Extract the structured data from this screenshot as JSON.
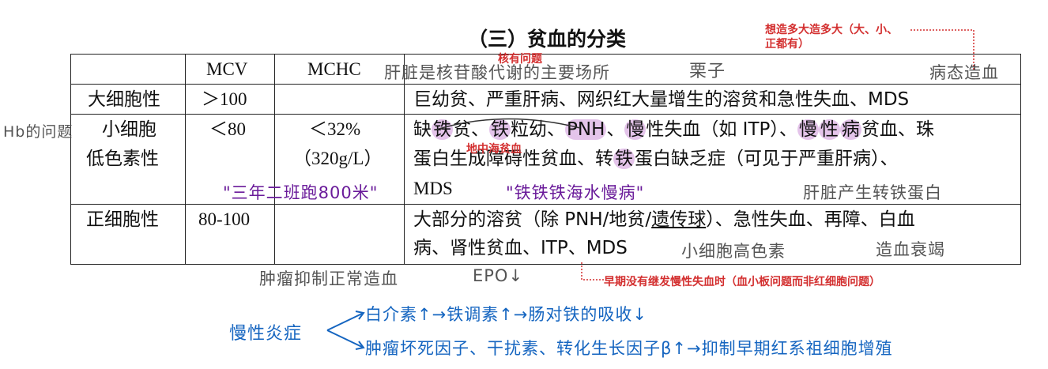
{
  "title": "（三）贫血的分类",
  "table": {
    "header": {
      "mcv": "MCV",
      "mchc": "MCHC"
    },
    "rows": [
      {
        "type": "大细胞性",
        "mcv": "＞100",
        "mchc": "",
        "diseases": "巨幼贫、严重肝病、网织红大量增生的溶贫和急性失血、MDS"
      },
      {
        "type_line1": "小细胞",
        "type_line2": "低色素性",
        "mcv": "＜80",
        "mchc_line1": "＜32%",
        "mchc_line2": "（320g/L）",
        "diseases_parts": [
          "缺",
          "铁",
          "贫、",
          "铁",
          "粒幼、",
          "PNH",
          "、",
          "慢",
          "性失血（如 ITP）、",
          "慢",
          "性",
          "病",
          "贫血、珠"
        ],
        "diseases_line2_parts": [
          "蛋白生成障碍性贫血、转",
          "铁",
          "蛋白缺乏症（可见于严重肝病）、"
        ],
        "diseases_line3": "MDS"
      },
      {
        "type": "正细胞性",
        "mcv": "80-100",
        "mchc": "",
        "diseases_line1_parts": [
          "大部分的溶贫（除 PNH/地贫/",
          "遗传球",
          "）、急性失血、再障、白血"
        ],
        "diseases_line2": "病、肾性贫血、ITP、MDS"
      }
    ]
  },
  "annotations": {
    "top_right_note_line1": "想造多大造多大（大、小、",
    "top_right_note_line2": "正都有）",
    "nuclear_problem": "核有问题",
    "liver_note": "肝脏是核苷酸代谢的主要场所",
    "chestnut": "栗子",
    "pathological_hematopoiesis": "病态造血",
    "hb_problem": "Hb的问题",
    "thalassemia": "地中海贫血",
    "mnemonic_1": "\"三年二班跑800米\"",
    "mnemonic_2": "\"铁铁铁海水慢病\"",
    "liver_transferrin": "肝脏产生转铁蛋白",
    "microcytic_hyperchromic": "小细胞高色素",
    "hematopoietic_failure": "造血衰竭",
    "tumor_inhibit": "肿瘤抑制正常造血",
    "epo": "EPO↓",
    "early_note": "早期没有继发慢性失血时（血小板问题而非红细胞问题）",
    "chronic_inflammation": "慢性炎症",
    "path1": "白介素↑→铁调素↑→肠对铁的吸收↓",
    "path2": "肿瘤坏死因子、干扰素、转化生长因子β↑→抑制早期红系祖细胞增殖"
  },
  "colors": {
    "red_note": "#d32f2f",
    "purple_hand": "#6a1b9a",
    "blue_hand": "#1565c0",
    "gray_hand": "#555555",
    "highlight": "#ce93d8"
  }
}
